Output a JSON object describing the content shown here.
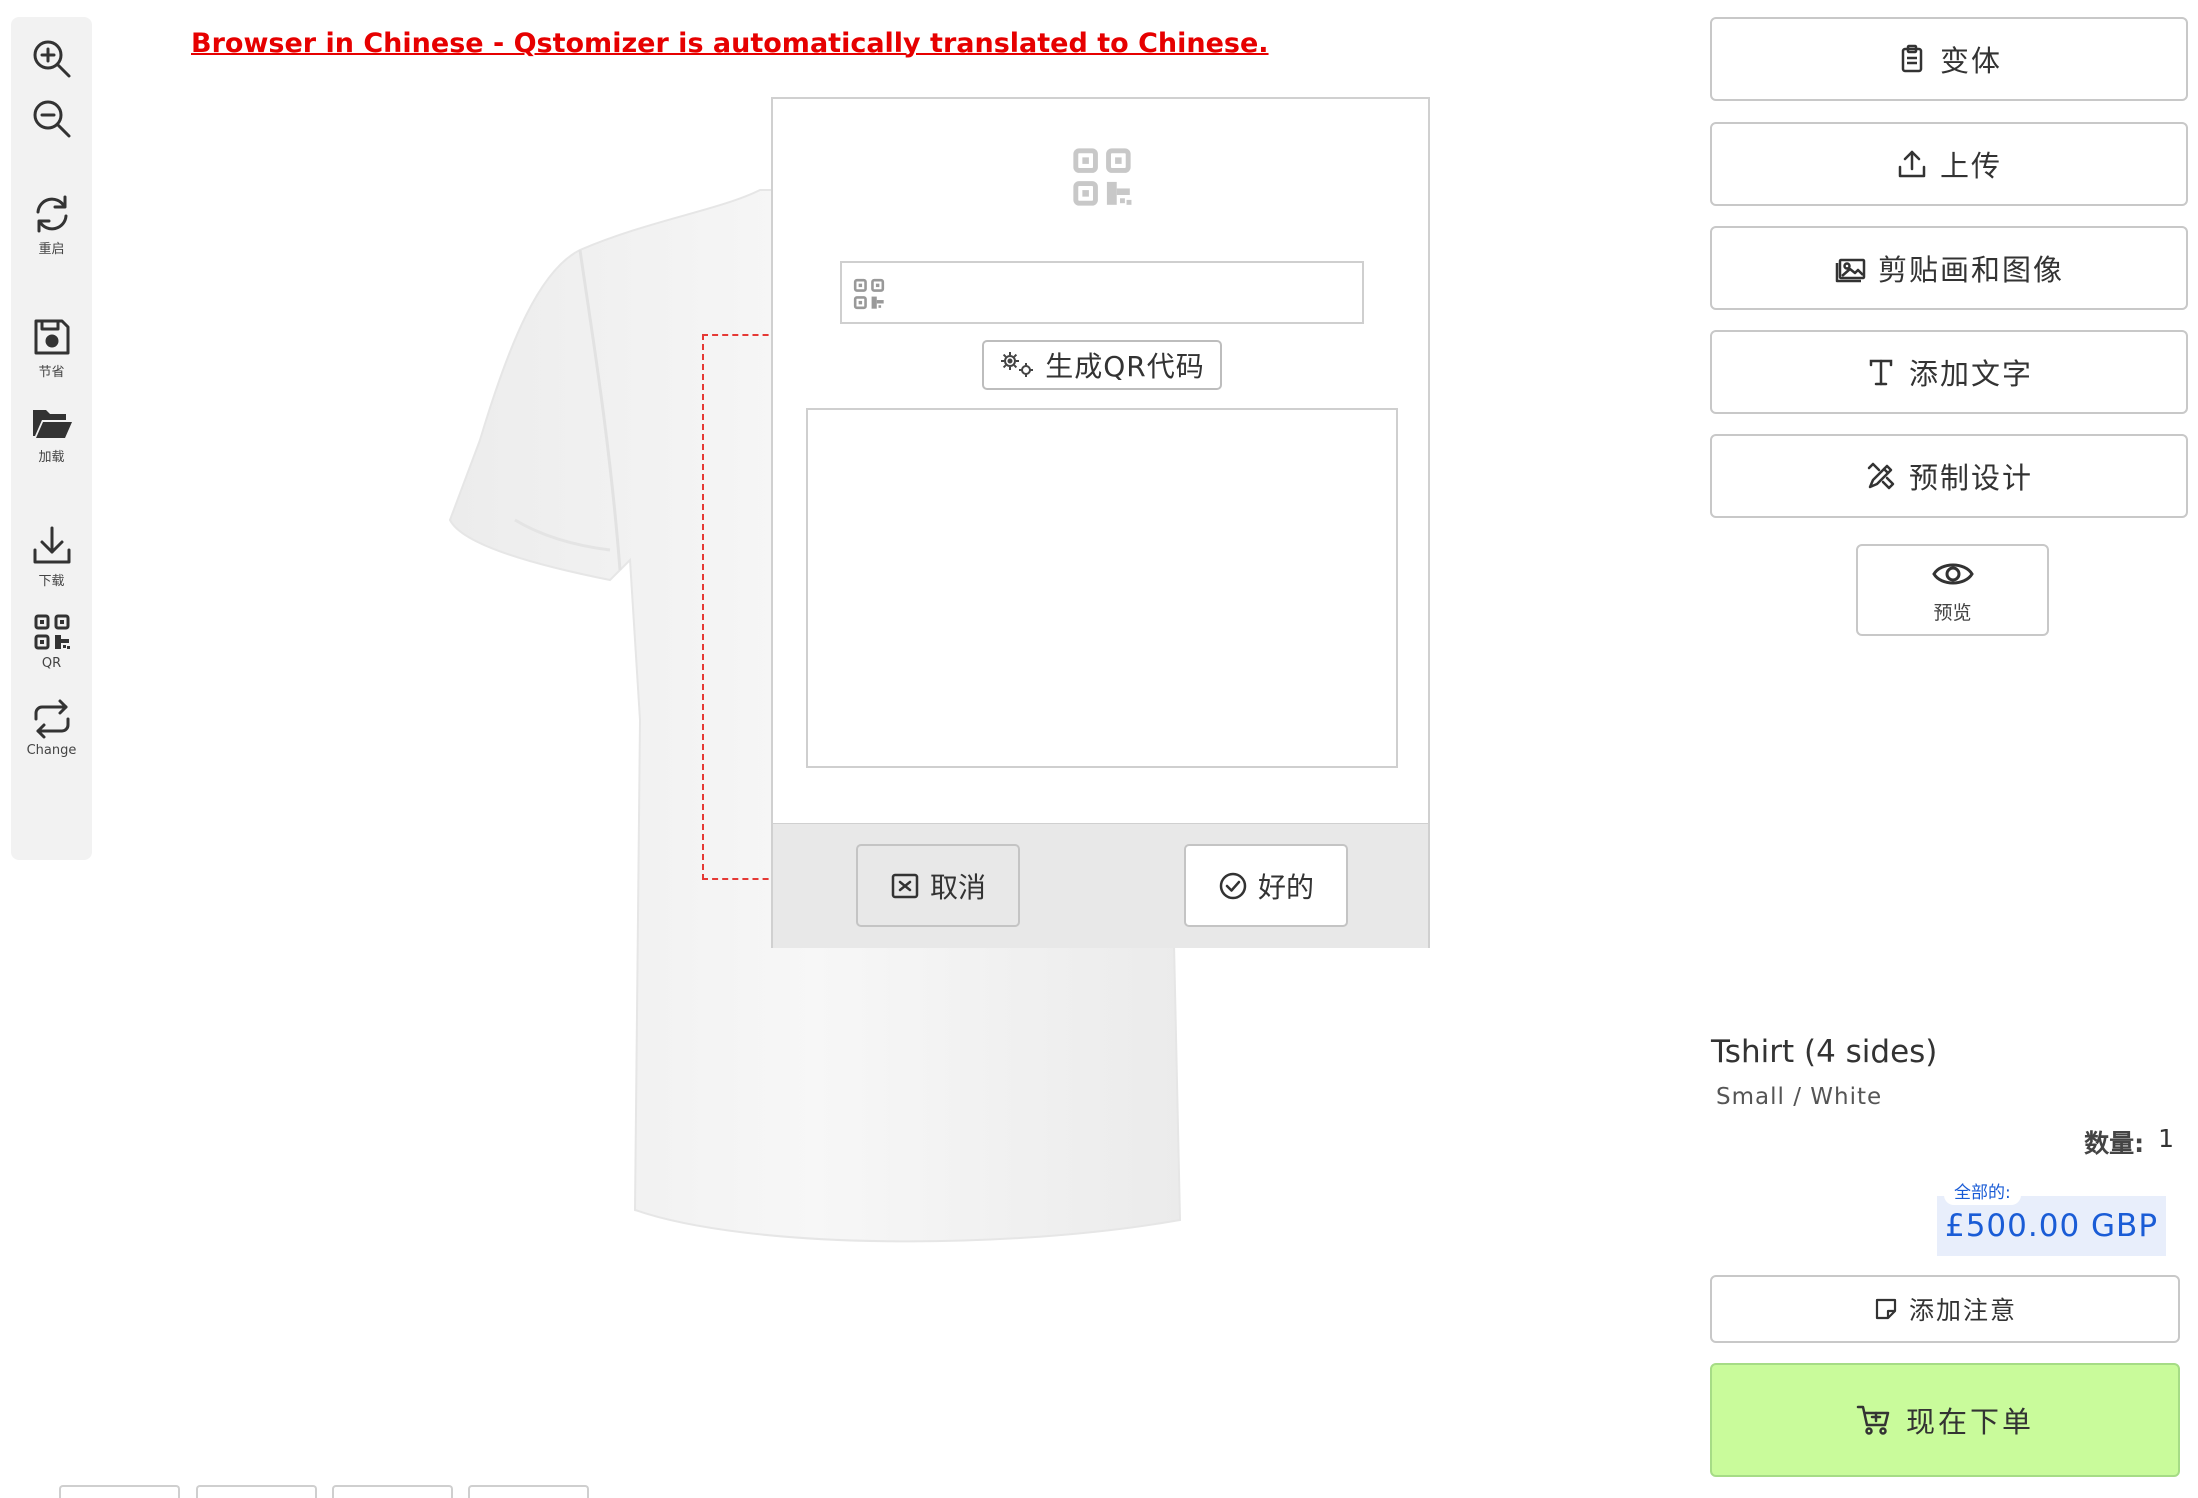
{
  "annotation": "Browser in Chinese - Qstomizer is automatically translated to Chinese.",
  "toolbar": {
    "items": [
      {
        "icon": "zoom-in-icon",
        "label": ""
      },
      {
        "icon": "zoom-out-icon",
        "label": ""
      },
      {
        "icon": "refresh-icon",
        "label": "重启"
      },
      {
        "icon": "save-icon",
        "label": "节省"
      },
      {
        "icon": "folder-open-icon",
        "label": "加载"
      },
      {
        "icon": "download-icon",
        "label": "下载"
      },
      {
        "icon": "qr-icon",
        "label": "QR"
      },
      {
        "icon": "swap-icon",
        "label": "Change"
      }
    ]
  },
  "qr_dialog": {
    "input_value": "",
    "generate_label": "生成QR代码",
    "cancel_label": "取消",
    "ok_label": "好的"
  },
  "right_panel": {
    "buttons": [
      {
        "icon": "clipboard-icon",
        "label": "变体"
      },
      {
        "icon": "upload-icon",
        "label": "上传"
      },
      {
        "icon": "image-icon",
        "label": "剪贴画和图像"
      },
      {
        "icon": "text-icon",
        "label": "添加文字"
      },
      {
        "icon": "design-tools-icon",
        "label": "预制设计"
      }
    ],
    "preview_label": "预览"
  },
  "product": {
    "title": "Tshirt (4 sides)",
    "variant": "Small / White",
    "quantity_label": "数量:",
    "quantity": "1",
    "total_label": "全部的:",
    "total": "£500.00 GBP"
  },
  "actions": {
    "note_label": "添加注意",
    "order_label": "现在下单"
  },
  "colors": {
    "accent_green": "#c9fb9b",
    "price_blue": "#1a5cd6",
    "annotation_red": "#e60000"
  }
}
